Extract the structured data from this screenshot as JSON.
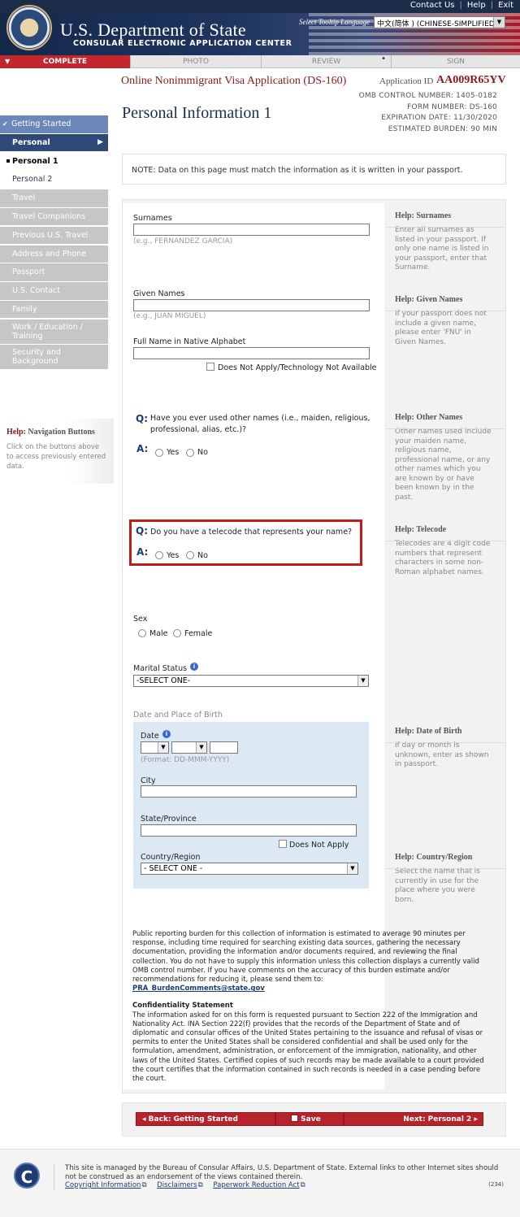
{
  "header": {
    "top_links": [
      "Contact Us",
      "Help",
      "Exit"
    ],
    "title_line": "U.S. Department of State",
    "subtitle": "CONSULAR ELECTRONIC APPLICATION CENTER",
    "lang_label": "Select Tooltip Language",
    "lang_value": "中文(简体 ) (CHINESE-SIMPLIFIED)"
  },
  "steps": [
    "COMPLETE",
    "PHOTO",
    "REVIEW",
    "SIGN"
  ],
  "app": {
    "title": "Online Nonimmigrant Visa Application (DS-160)",
    "id_label": "Application ID",
    "id_value": "AA009R65YV",
    "omb": [
      {
        "label": "OMB CONTROL NUMBER:",
        "value": "1405-0182"
      },
      {
        "label": "FORM NUMBER:",
        "value": "DS-160"
      },
      {
        "label": "EXPIRATION DATE:",
        "value": "11/30/2020"
      },
      {
        "label": "ESTIMATED BURDEN:",
        "value": "90 MIN"
      }
    ],
    "page_title": "Personal Information 1"
  },
  "nav": {
    "getting_started": "Getting Started",
    "personal": "Personal",
    "personal1": "Personal 1",
    "personal2": "Personal 2",
    "travel": "Travel",
    "travel_companions": "Travel Companions",
    "previous_travel": "Previous U.S. Travel",
    "address_phone": "Address and Phone",
    "passport": "Passport",
    "us_contact": "U.S. Contact",
    "family": "Family",
    "work_l1": "Work / Education /",
    "work_l2": "Training",
    "security_l1": "Security and",
    "security_l2": "Background"
  },
  "help_nav": {
    "head": "Help:",
    "title": "Navigation Buttons",
    "body": "Click on the buttons above to access previously entered data."
  },
  "notice": "NOTE: Data on this page must match the information as it is written in your passport.",
  "form": {
    "surnames_label": "Surnames",
    "surnames_hint": "(e.g., FERNANDEZ GARCIA)",
    "given_label": "Given Names",
    "given_hint": "(e.g., JUAN MIGUEL)",
    "native_label": "Full Name in Native Alphabet",
    "native_na": "Does Not Apply/Technology Not Available",
    "other_names_q": "Have you ever used other names (i.e., maiden, religious, professional, alias, etc.)?",
    "telecode_q": "Do you have a telecode that represents your name?",
    "q_mark": "Q:",
    "a_mark": "A:",
    "yes": "Yes",
    "no": "No",
    "sex_label": "Sex",
    "male": "Male",
    "female": "Female",
    "marital_label": "Marital Status",
    "marital_value": "-SELECT ONE-",
    "dob_section": "Date and Place of Birth",
    "date_label": "Date",
    "date_hint": "(Format: DD-MMM-YYYY)",
    "city_label": "City",
    "state_label": "State/Province",
    "state_na": "Does Not Apply",
    "country_label": "Country/Region",
    "country_value": "- SELECT ONE -"
  },
  "help": {
    "head": "Help:",
    "surnames_title": "Surnames",
    "surnames_body": "Enter all surnames as listed in your passport. If only one name is listed in your passport, enter that Surname.",
    "given_title": "Given Names",
    "given_body": "If your passport does not include a given name, please enter 'FNU' in Given Names.",
    "other_title": "Other Names",
    "other_body": "Other names used include your maiden name, religious name, professional name, or any other names which you are known by or have been known by in the past.",
    "telecode_title": "Telecode",
    "telecode_body": "Telecodes are 4 digit code numbers that represent characters in some non-Roman alphabet names.",
    "dob_title": "Date of Birth",
    "dob_body": "If day or month is unknown, enter as shown in passport.",
    "country_title": "Country/Region",
    "country_body": "Select the name that is currently in use for the place where you were born."
  },
  "legal": {
    "burden": "Public reporting burden for this collection of information is estimated to average 90 minutes per response, including time required for searching existing data sources, gathering the necessary documentation, providing the information and/or documents required, and reviewing the final collection. You do not have to supply this information unless this collection displays a currently valid OMB control number. If you have comments on the accuracy of this burden estimate and/or recommendations for reducing it, please send them to:",
    "email": "PRA_BurdenComments@state.gov",
    "conf_title": "Confidentiality Statement",
    "conf_body": "The information asked for on this form is requested pursuant to Section 222 of the Immigration and Nationality Act. INA Section 222(f) provides that the records of the Department of State and of diplomatic and consular offices of the United States pertaining to the issuance and refusal of visas or permits to enter the United States shall be considered confidential and shall be used only for the formulation, amendment, administration, or enforcement of the immigration, nationality, and other laws of the United States. Certified copies of such records may be made available to a court provided the court certifies that the information contained in such records is needed in a case pending before the court."
  },
  "buttons": {
    "back": "Back: Getting Started",
    "save": "Save",
    "next": "Next: Personal 2"
  },
  "footer": {
    "text": "This site is managed by the Bureau of Consular Affairs, U.S. Department of State. External links to other Internet sites should not be construed as an endorsement of the views contained therein.",
    "links": [
      "Copyright Information",
      "Disclaimers",
      "Paperwork Reduction Act"
    ],
    "code": "(234)",
    "logo": "C"
  }
}
